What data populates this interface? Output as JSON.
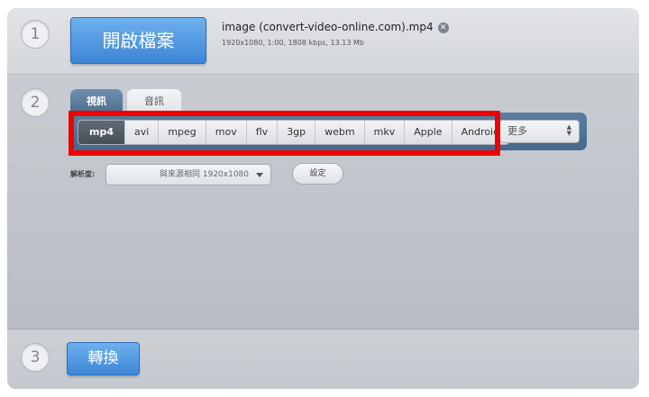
{
  "steps": {
    "one": "1",
    "two": "2",
    "three": "3"
  },
  "step1": {
    "open_button_label": "開啟檔案",
    "file_name": "image (convert-video-online.com).mp4",
    "file_info": "1920x1080, 1:00, 1808 kbps, 13.13 Mb",
    "remove_icon": "close-circle-icon"
  },
  "step2": {
    "tabs": [
      {
        "label": "視訊",
        "active": true
      },
      {
        "label": "音訊",
        "active": false
      }
    ],
    "formats": [
      "mp4",
      "avi",
      "mpeg",
      "mov",
      "flv",
      "3gp",
      "webm",
      "mkv",
      "Apple",
      "Android"
    ],
    "selected_format": "mp4",
    "more_label": "更多",
    "resolution_label": "解析度:",
    "resolution_value": "與來源相同 1920x1080",
    "settings_label": "設定"
  },
  "step3": {
    "convert_label": "轉換"
  },
  "colors": {
    "highlight": "#ee0000",
    "button_blue": "#3d86d6",
    "tab_active": "#4f7090"
  }
}
